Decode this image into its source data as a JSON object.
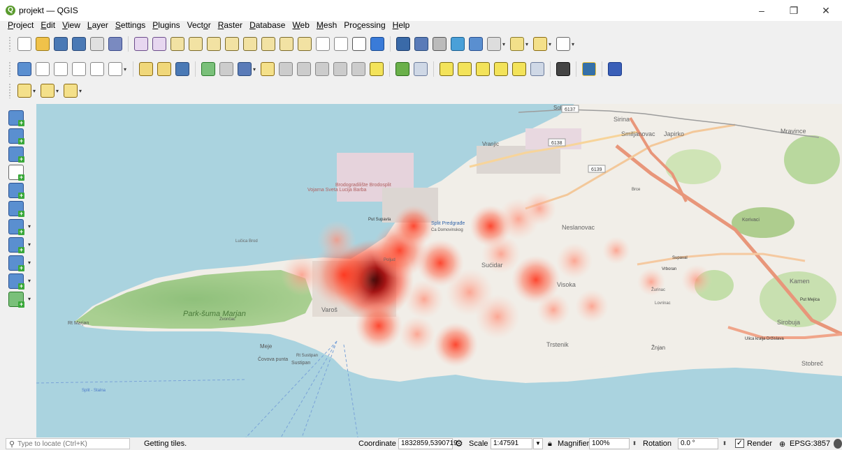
{
  "window": {
    "title": "projekt — QGIS",
    "app_icon": "Q",
    "controls": {
      "minimize": "–",
      "restore": "❐",
      "close": "✕"
    }
  },
  "menu": [
    {
      "label": "Project",
      "u": "P",
      "rest": "roject"
    },
    {
      "label": "Edit",
      "u": "E",
      "rest": "dit"
    },
    {
      "label": "View",
      "u": "V",
      "rest": "iew"
    },
    {
      "label": "Layer",
      "u": "L",
      "rest": "ayer"
    },
    {
      "label": "Settings",
      "u": "S",
      "rest": "ettings"
    },
    {
      "label": "Plugins",
      "u": "P",
      "rest": "lugins"
    },
    {
      "label": "Vector",
      "pre": "Vect",
      "u": "o",
      "rest": "r"
    },
    {
      "label": "Raster",
      "u": "R",
      "rest": "aster"
    },
    {
      "label": "Database",
      "u": "D",
      "rest": "atabase"
    },
    {
      "label": "Web",
      "u": "W",
      "rest": "eb"
    },
    {
      "label": "Mesh",
      "u": "M",
      "rest": "esh"
    },
    {
      "label": "Processing",
      "pre": "Pro",
      "u": "c",
      "rest": "essing"
    },
    {
      "label": "Help",
      "u": "H",
      "rest": "elp"
    }
  ],
  "toolbar_icons": {
    "row1": [
      "new-project",
      "open-project",
      "save-project",
      "save-as",
      "print-layout",
      "style-manager",
      "pan-map",
      "pan-to-selection",
      "zoom-in",
      "zoom-out",
      "zoom-full",
      "zoom-to-selection",
      "zoom-to-layer",
      "zoom-native",
      "zoom-last",
      "zoom-next",
      "new-map-view",
      "new-3d-view",
      "temporal-controller",
      "refresh",
      "identify",
      "attribute-table",
      "field-calculator",
      "processing-toolbox",
      "statistics",
      "measure",
      "map-tips",
      "select-by-location",
      "text-annotation"
    ],
    "row2": [
      "data-source-manager",
      "new-geopackage",
      "new-shapefile",
      "new-spatialite",
      "new-virtual-layer",
      "new-memory-layer",
      "current-edits",
      "toggle-editing",
      "save-edits",
      "add-point",
      "vertex-tool",
      "modify-attributes",
      "delete-selected",
      "cut-features",
      "copy-features",
      "paste-features",
      "undo",
      "redo",
      "label-tool",
      "diagram-tool",
      "highlight-pinned",
      "show-hide-labels",
      "move-label",
      "rotate-label",
      "change-label",
      "pin-label",
      "move-diagram",
      "grass-tools",
      "python-console",
      "help"
    ],
    "row3": [
      "select-features",
      "deselect",
      "select-by-expression"
    ]
  },
  "left_toolbar": [
    "add-vector-layer",
    "add-raster-layer",
    "add-mesh-layer",
    "add-delimited-text",
    "add-spatialite-layer",
    "add-virtual-layer",
    "add-wms-layer",
    "add-wfs-layer",
    "add-wcs-layer",
    "add-arcgis-layer",
    "add-vector-tile"
  ],
  "map": {
    "labels": [
      "Solin",
      "Vranjic",
      "Brodogradilište Brodosplit",
      "Vojarna Sveta Lucija Barba",
      "Split Predgrađe",
      "Ca Domovinskog",
      "Put Supavla",
      "Neslanovac",
      "Sućidar",
      "Visoka",
      "Smiljanovac",
      "Japirko",
      "Mravince",
      "Korivaci",
      "Kamen",
      "Sirobuja",
      "Stobreč",
      "Žnjan",
      "Trstenik",
      "Put Supavla",
      "Park-šuma Marjan",
      "Rt Marjan",
      "Sustipan",
      "Meje",
      "Varoš",
      "Čovova punta",
      "Rt Sustipan",
      "Split - Stalna",
      "Zvončac",
      "Lučica Brod",
      "Sirina",
      "Brce",
      "Lovrinac",
      "Ulica kralja Držislava",
      "Put Mejica",
      "Žurinac",
      "Poljud",
      "Vrboran",
      "Supaval"
    ],
    "road_numbers": [
      "6137",
      "6138",
      "6139"
    ]
  },
  "statusbar": {
    "locator_placeholder": "Type to locate (Ctrl+K)",
    "message": "Getting tiles.",
    "coordinate_label": "Coordinate",
    "coordinate_value": "1832859,5390719",
    "scale_label": "Scale",
    "scale_value": "1:47591",
    "magnifier_label": "Magnifier",
    "magnifier_value": "100%",
    "rotation_label": "Rotation",
    "rotation_value": "0.0 °",
    "render_label": "Render",
    "render_checked": true,
    "crs": "EPSG:3857"
  }
}
